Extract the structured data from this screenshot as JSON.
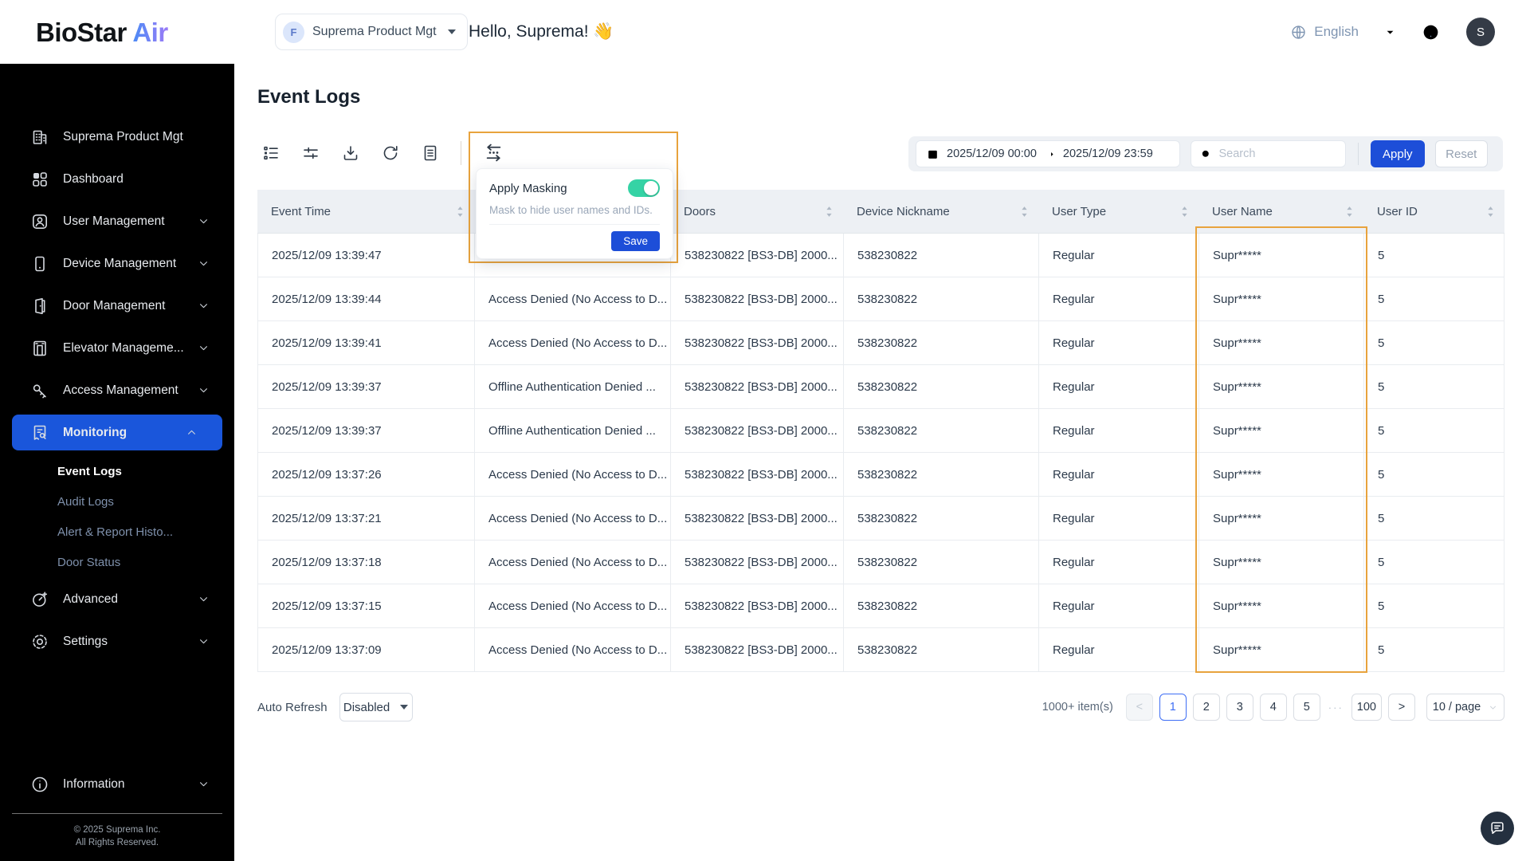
{
  "colors": {
    "sidebar_bg": "#000000",
    "active_menu_blue": "#1a56db",
    "primary_blue": "#1d4ed8",
    "highlight_orange": "#e8a33d",
    "toggle_green": "#35d3a5"
  },
  "header": {
    "logo_biostar": "BioStar",
    "logo_air": "Air",
    "org_badge": "F",
    "org_name": "Suprema Product Mgt",
    "greeting": "Hello, Suprema! 👋",
    "language": "English",
    "avatar_initial": "S"
  },
  "sidebar": {
    "items_top": [
      {
        "label": "Suprema Product Mgt",
        "icon": "building",
        "chevron": "",
        "active": false
      },
      {
        "label": "Dashboard",
        "icon": "dashboard",
        "chevron": "",
        "active": false
      },
      {
        "label": "User Management",
        "icon": "user",
        "chevron": "down",
        "active": false
      },
      {
        "label": "Device Management",
        "icon": "device",
        "chevron": "down",
        "active": false
      },
      {
        "label": "Door Management",
        "icon": "door",
        "chevron": "down",
        "active": false
      },
      {
        "label": "Elevator Manageme...",
        "icon": "elevator",
        "chevron": "down",
        "active": false
      },
      {
        "label": "Access Management",
        "icon": "key",
        "chevron": "down",
        "active": false
      },
      {
        "label": "Monitoring",
        "icon": "monitoring",
        "chevron": "up",
        "active": true
      }
    ],
    "monitoring_children": [
      {
        "label": "Event Logs",
        "active": true
      },
      {
        "label": "Audit Logs",
        "active": false
      },
      {
        "label": "Alert & Report Histo...",
        "active": false
      },
      {
        "label": "Door Status",
        "active": false
      }
    ],
    "items_bottom": [
      {
        "label": "Advanced",
        "icon": "advanced",
        "chevron": "down",
        "active": false
      },
      {
        "label": "Settings",
        "icon": "gear",
        "chevron": "down",
        "active": false
      }
    ],
    "information": {
      "label": "Information",
      "icon": "info",
      "chevron": "down"
    },
    "copyright_line1": "© 2025 Suprema Inc.",
    "copyright_line2": "All Rights Reserved."
  },
  "page": {
    "title": "Event Logs"
  },
  "masking": {
    "title": "Apply Masking",
    "description": "Mask to hide user names and IDs.",
    "save_label": "Save",
    "enabled": true
  },
  "filters": {
    "date_from": "2025/12/09 00:00",
    "date_to": "2025/12/09 23:59",
    "search_placeholder": "Search",
    "apply_label": "Apply",
    "reset_label": "Reset"
  },
  "table": {
    "columns": [
      {
        "label": "Event Time",
        "sort": true
      },
      {
        "label": "",
        "sort": false
      },
      {
        "label": "Doors",
        "sort": true
      },
      {
        "label": "Device Nickname",
        "sort": true
      },
      {
        "label": "User Type",
        "sort": true
      },
      {
        "label": "User Name",
        "sort": true
      },
      {
        "label": "User ID",
        "sort": true
      }
    ],
    "rows": [
      {
        "time": "2025/12/09 13:39:47",
        "event": "",
        "doors": "538230822 [BS3-DB] 2000...",
        "device": "538230822",
        "user_type": "Regular",
        "user_name": "Supr*****",
        "user_id": "5"
      },
      {
        "time": "2025/12/09 13:39:44",
        "event": "Access Denied (No Access to D...",
        "doors": "538230822 [BS3-DB] 2000...",
        "device": "538230822",
        "user_type": "Regular",
        "user_name": "Supr*****",
        "user_id": "5"
      },
      {
        "time": "2025/12/09 13:39:41",
        "event": "Access Denied (No Access to D...",
        "doors": "538230822 [BS3-DB] 2000...",
        "device": "538230822",
        "user_type": "Regular",
        "user_name": "Supr*****",
        "user_id": "5"
      },
      {
        "time": "2025/12/09 13:39:37",
        "event": "Offline Authentication Denied ...",
        "doors": "538230822 [BS3-DB] 2000...",
        "device": "538230822",
        "user_type": "Regular",
        "user_name": "Supr*****",
        "user_id": "5"
      },
      {
        "time": "2025/12/09 13:39:37",
        "event": "Offline Authentication Denied ...",
        "doors": "538230822 [BS3-DB] 2000...",
        "device": "538230822",
        "user_type": "Regular",
        "user_name": "Supr*****",
        "user_id": "5"
      },
      {
        "time": "2025/12/09 13:37:26",
        "event": "Access Denied (No Access to D...",
        "doors": "538230822 [BS3-DB] 2000...",
        "device": "538230822",
        "user_type": "Regular",
        "user_name": "Supr*****",
        "user_id": "5"
      },
      {
        "time": "2025/12/09 13:37:21",
        "event": "Access Denied (No Access to D...",
        "doors": "538230822 [BS3-DB] 2000...",
        "device": "538230822",
        "user_type": "Regular",
        "user_name": "Supr*****",
        "user_id": "5"
      },
      {
        "time": "2025/12/09 13:37:18",
        "event": "Access Denied (No Access to D...",
        "doors": "538230822 [BS3-DB] 2000...",
        "device": "538230822",
        "user_type": "Regular",
        "user_name": "Supr*****",
        "user_id": "5"
      },
      {
        "time": "2025/12/09 13:37:15",
        "event": "Access Denied (No Access to D...",
        "doors": "538230822 [BS3-DB] 2000...",
        "device": "538230822",
        "user_type": "Regular",
        "user_name": "Supr*****",
        "user_id": "5"
      },
      {
        "time": "2025/12/09 13:37:09",
        "event": "Access Denied (No Access to D...",
        "doors": "538230822 [BS3-DB] 2000...",
        "device": "538230822",
        "user_type": "Regular",
        "user_name": "Supr*****",
        "user_id": "5"
      }
    ]
  },
  "footer": {
    "auto_refresh_label": "Auto Refresh",
    "auto_refresh_value": "Disabled",
    "items_count": "1000+ item(s)",
    "prev": "<",
    "pages": [
      {
        "label": "1",
        "active": true
      },
      {
        "label": "2",
        "active": false
      },
      {
        "label": "3",
        "active": false
      },
      {
        "label": "4",
        "active": false
      },
      {
        "label": "5",
        "active": false
      }
    ],
    "ellipsis": "···",
    "last_page": "100",
    "next": ">",
    "page_size": "10 / page"
  }
}
